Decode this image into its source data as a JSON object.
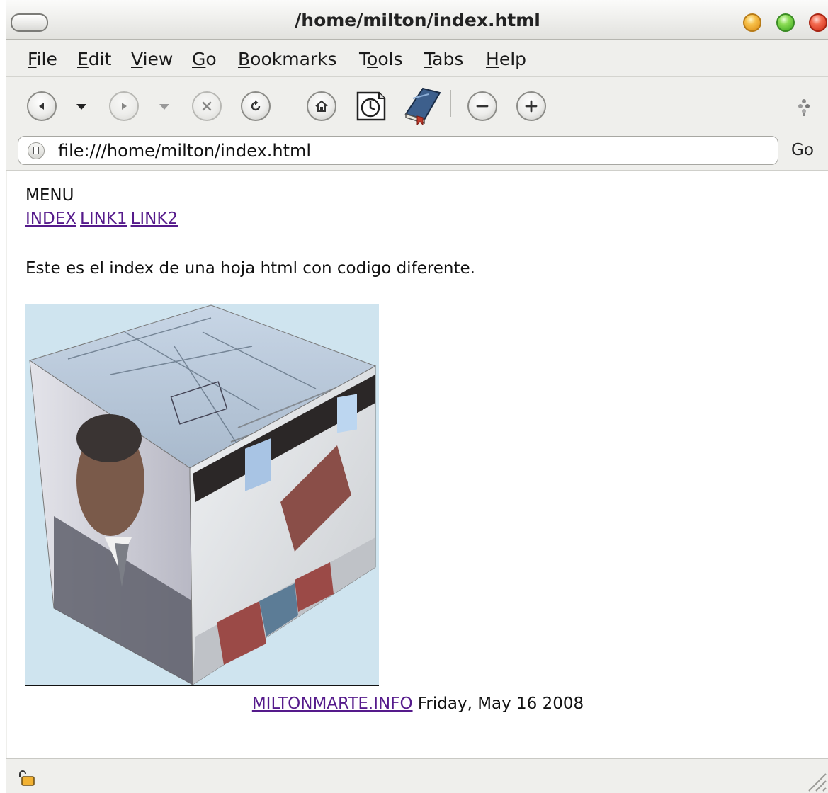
{
  "window": {
    "title": "/home/milton/index.html"
  },
  "menubar": {
    "items": [
      {
        "mnemonic": "F",
        "rest": "ile"
      },
      {
        "mnemonic": "E",
        "rest": "dit"
      },
      {
        "mnemonic": "V",
        "rest": "iew"
      },
      {
        "mnemonic": "G",
        "rest": "o"
      },
      {
        "mnemonic": "B",
        "rest": "ookmarks"
      },
      {
        "pre": "T",
        "mnemonic": "o",
        "rest": "ols"
      },
      {
        "mnemonic": "T",
        "rest": "abs"
      },
      {
        "mnemonic": "H",
        "rest": "elp"
      }
    ]
  },
  "toolbar": {
    "icons": [
      "back-icon",
      "forward-icon",
      "stop-icon",
      "reload-icon",
      "home-icon",
      "history-icon",
      "bookmarks-icon",
      "zoom-out-icon",
      "zoom-in-icon",
      "throbber-icon"
    ]
  },
  "urlbar": {
    "url": "file:///home/milton/index.html",
    "go_label": "Go"
  },
  "page": {
    "menu_heading": "MENU",
    "links": [
      "INDEX",
      "LINK1",
      "LINK2"
    ],
    "intro": "Este es el index de una hoja html con codigo diferente.",
    "footer_link": "MILTONMARTE.INFO",
    "footer_date": "Friday, May 16 2008"
  },
  "colors": {
    "link_visited": "#551a8b",
    "cube_background": "#cfe4ef"
  }
}
